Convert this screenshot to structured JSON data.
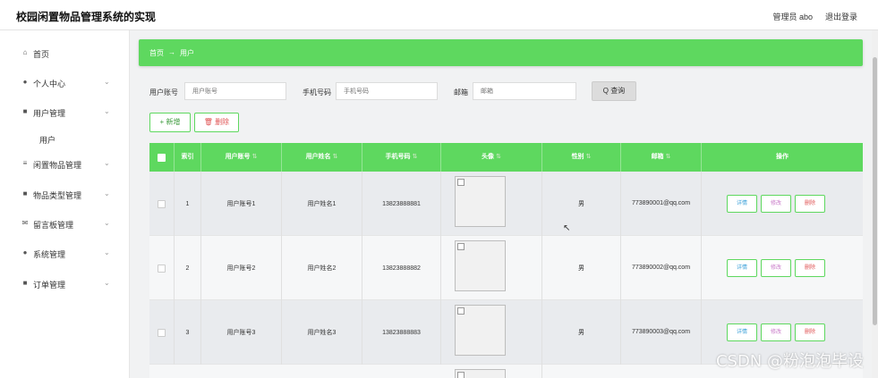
{
  "header": {
    "title": "校园闲置物品管理系统的实现",
    "admin": "管理员 abo",
    "logout": "退出登录"
  },
  "sidebar": {
    "items": [
      {
        "icon": "home-icon",
        "label": "首页"
      },
      {
        "icon": "user-icon",
        "label": "个人中心"
      },
      {
        "icon": "grid-icon",
        "label": "用户管理"
      },
      {
        "icon": "list-icon",
        "label": "闲置物品管理"
      },
      {
        "icon": "grid-icon",
        "label": "物品类型管理"
      },
      {
        "icon": "message-icon",
        "label": "留言板管理"
      },
      {
        "icon": "user-icon",
        "label": "系统管理"
      },
      {
        "icon": "grid-icon",
        "label": "订单管理"
      }
    ],
    "sub": "用户"
  },
  "breadcrumb": {
    "home": "首页",
    "arrow": "→",
    "current": "用户"
  },
  "search": {
    "account_label": "用户账号",
    "account_placeholder": "用户账号",
    "phone_label": "手机号码",
    "phone_placeholder": "手机号码",
    "email_label": "邮箱",
    "email_placeholder": "邮箱",
    "button": "Q 查询"
  },
  "toolbar": {
    "add": "+ 新增",
    "delete": "🗑 删除"
  },
  "table": {
    "headers": [
      "索引",
      "用户账号",
      "用户姓名",
      "手机号码",
      "头像",
      "性别",
      "邮箱",
      "操作"
    ],
    "sort_glyph": "⇅",
    "rows": [
      {
        "index": "1",
        "account": "用户账号1",
        "name": "用户姓名1",
        "phone": "13823888881",
        "gender": "男",
        "email": "773890001@qq.com"
      },
      {
        "index": "2",
        "account": "用户账号2",
        "name": "用户姓名2",
        "phone": "13823888882",
        "gender": "男",
        "email": "773890002@qq.com"
      },
      {
        "index": "3",
        "account": "用户账号3",
        "name": "用户姓名3",
        "phone": "13823888883",
        "gender": "男",
        "email": "773890003@qq.com"
      }
    ],
    "actions": {
      "detail": "详情",
      "edit": "修改",
      "remove": "删除"
    }
  },
  "watermark": "CSDN @粉泡泡毕设",
  "colors": {
    "accent": "#5ed85f"
  }
}
